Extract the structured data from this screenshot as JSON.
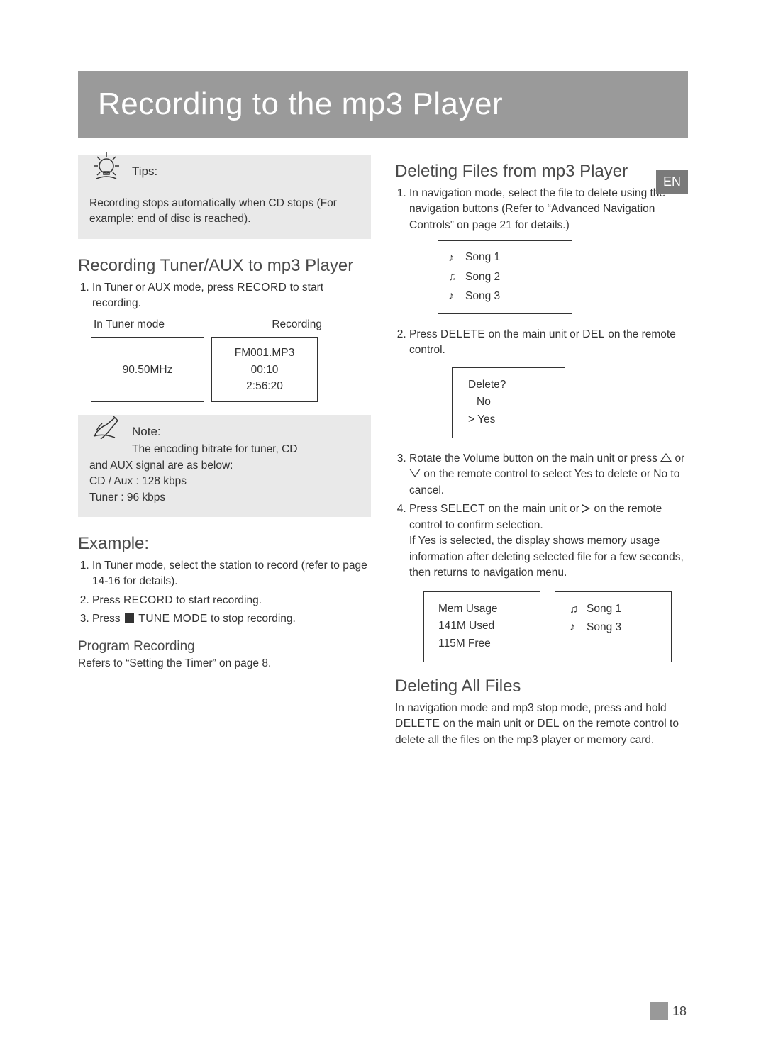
{
  "banner_title": "Recording to the mp3 Player",
  "lang_tag": "EN",
  "page_number": "18",
  "left": {
    "tips_label": "Tips:",
    "tips_body": "Recording stops automatically when CD stops (For example: end of disc is reached).",
    "section1_heading": "Recording Tuner/AUX to mp3 Player",
    "step1_pre": "In Tuner or AUX mode, press ",
    "step1_btn": "RECORD",
    "step1_post": " to start recording.",
    "lcd_label_left": "In Tuner mode",
    "lcd_label_right": "Recording",
    "lcd_tuner_value": "90.50MHz",
    "lcd_rec_file": "FM001.MP3",
    "lcd_rec_elapsed": "00:10",
    "lcd_rec_remain": "2:56:20",
    "note_label": "Note:",
    "note_line1": "The encoding bitrate for tuner, CD",
    "note_line2": "and AUX signal are as below:",
    "note_line3": "CD / Aux : 128 kbps",
    "note_line4": "Tuner : 96 kbps",
    "example_heading": "Example:",
    "ex1": "In Tuner mode, select the station to record (refer to page 14-16 for details).",
    "ex2_pre": "Press ",
    "ex2_btn": "RECORD",
    "ex2_post": " to start recording.",
    "ex3_pre": "Press ",
    "ex3_btn": "TUNE MODE",
    "ex3_post": " to stop recording.",
    "program_rec_heading": "Program Recording",
    "program_rec_body": "Refers to “Setting the Timer” on page 8."
  },
  "right": {
    "section2_heading": "Deleting Files from mp3 Player",
    "d1": "In navigation mode, select the file to delete using the navigation buttons (Refer to “Advanced Navigation Controls” on page 21 for details.)",
    "songs": [
      "Song 1",
      "Song 2",
      "Song 3"
    ],
    "d2_pre": "Press ",
    "d2_btn1": "DELETE",
    "d2_mid": " on the main unit or ",
    "d2_btn2": "DEL",
    "d2_post": " on the remote control.",
    "delete_prompt": "Delete?",
    "delete_no": "No",
    "delete_yes": "> Yes",
    "d3_pre": "Rotate the Volume button on the main unit or press ",
    "d3_mid": " or ",
    "d3_post": " on the remote control to select Yes to delete or No to cancel.",
    "d4_pre": "Press ",
    "d4_btn": "SELECT",
    "d4_mid": " on the main unit or ",
    "d4_post": " on the remote control to confirm selection.",
    "d4_extra": "If Yes is selected, the display shows memory usage information after deleting selected file for a few seconds, then returns to navigation menu.",
    "mem_title": "Mem Usage",
    "mem_used": "141M Used",
    "mem_free": "115M Free",
    "songs_after": [
      "Song 1",
      "Song 3"
    ],
    "section3_heading": "Deleting All Files",
    "del_all_body_pre": "In navigation mode and mp3 stop mode, press and hold ",
    "del_all_btn1": "DELETE",
    "del_all_mid": " on the main unit or ",
    "del_all_btn2": "DEL",
    "del_all_post": " on the remote control to delete all the files on the mp3 player or memory card."
  }
}
